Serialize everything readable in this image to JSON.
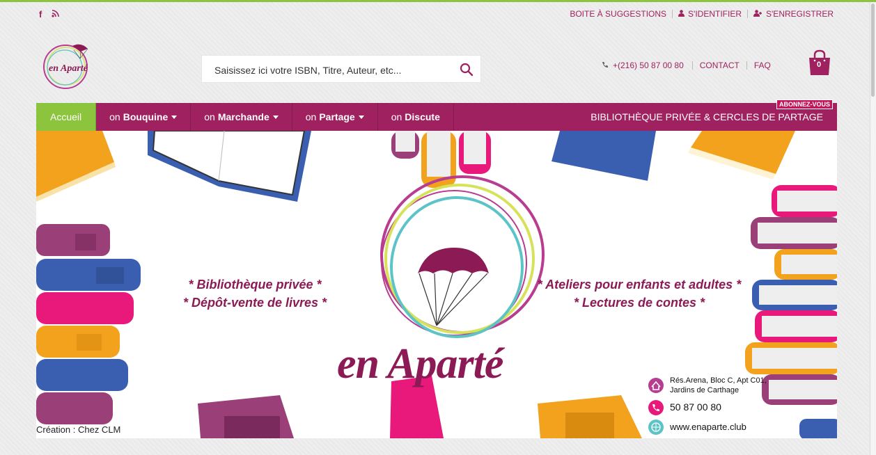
{
  "topbar": {
    "social": [
      "facebook-icon",
      "rss-icon"
    ],
    "links": [
      {
        "label": "BOITE À SUGGESTIONS",
        "icon": ""
      },
      {
        "label": "S'IDENTIFIER",
        "icon": "user-icon"
      },
      {
        "label": "S'ENREGISTRER",
        "icon": "user-plus-icon"
      }
    ]
  },
  "search": {
    "placeholder": "Saisissez ici votre ISBN, Titre, Auteur, etc..."
  },
  "contact": {
    "phone": "+(216) 50 87 00 80",
    "contact_label": "CONTACT",
    "faq_label": "FAQ"
  },
  "cart": {
    "count": "0"
  },
  "nav": {
    "home": "Accueil",
    "items": [
      {
        "prefix": "on",
        "label": "Bouquine",
        "dropdown": true
      },
      {
        "prefix": "on",
        "label": "Marchande",
        "dropdown": true
      },
      {
        "prefix": "on",
        "label": "Partage",
        "dropdown": true
      },
      {
        "prefix": "on",
        "label": "Discute",
        "dropdown": false
      }
    ],
    "right_label": "BIBLIOTHÈQUE PRIVÉE & CERCLES DE PARTAGE",
    "badge": "ABONNEZ-VOUS"
  },
  "banner": {
    "left_lines": [
      "* Bibliothèque privée *",
      "* Dépôt-vente de livres *"
    ],
    "right_lines": [
      "* Ateliers pour enfants et adultes *",
      "* Lectures de contes *"
    ],
    "brand": "en Aparté",
    "credit": "Création : Chez CLM",
    "address": [
      "Rés.Arena, Bloc C, Apt C01,",
      "Jardins de Carthage"
    ],
    "phone": "50 87 00 80",
    "website": "www.enaparte.club"
  },
  "colors": {
    "brand": "#a0215f",
    "accent": "#8cc43e"
  }
}
